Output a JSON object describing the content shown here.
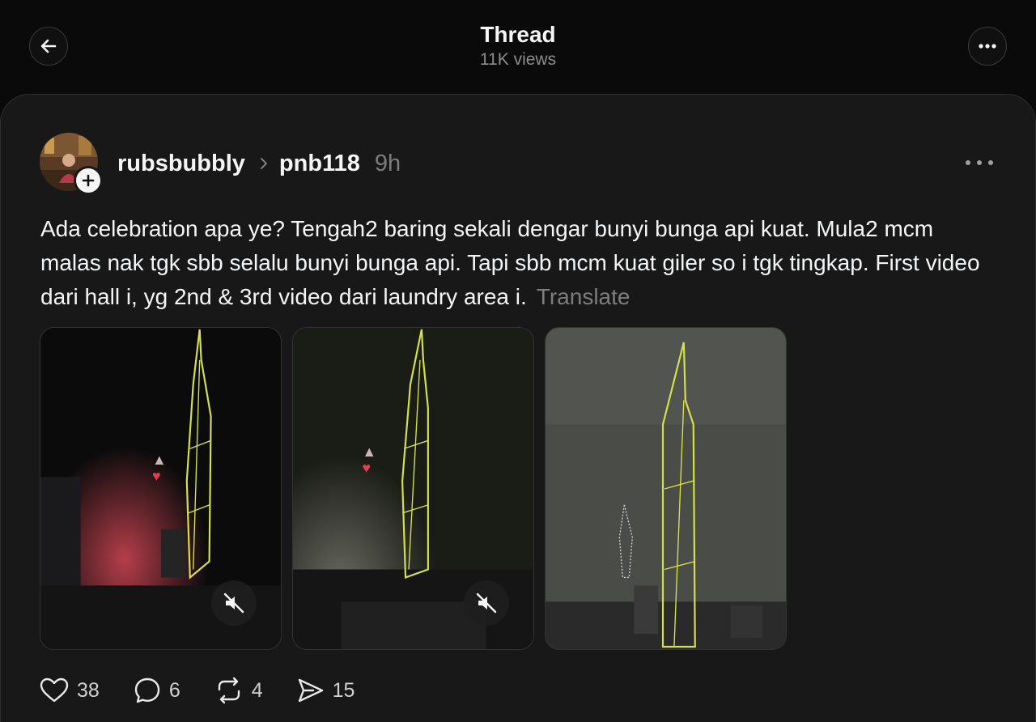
{
  "header": {
    "title": "Thread",
    "views": "11K views"
  },
  "post": {
    "username": "rubsbubbly",
    "topic": "pnb118",
    "time": "9h",
    "text": "Ada celebration apa ye? Tengah2 baring sekali dengar bunyi bunga api kuat. Mula2 mcm malas nak tgk sbb selalu bunyi bunga api. Tapi sbb mcm kuat giler so i tgk tingkap. First video dari hall i, yg 2nd & 3rd video dari laundry area i.",
    "translate_label": "Translate",
    "media": [
      {
        "kind": "video",
        "muted": true
      },
      {
        "kind": "video",
        "muted": true
      },
      {
        "kind": "image"
      }
    ],
    "stats": {
      "likes": "38",
      "replies": "6",
      "reposts": "4",
      "shares": "15"
    }
  },
  "icons": [
    "back-arrow-icon",
    "more-icon",
    "plus-icon",
    "chevron-right-icon",
    "muted-speaker-icon",
    "heart-icon",
    "comment-icon",
    "repost-icon",
    "send-icon"
  ],
  "colors": {
    "background": "#0a0a0a",
    "card": "#181818",
    "text": "#f3f5f7",
    "muted_text": "#7d7d7d",
    "tower_light": "#d6e04a"
  }
}
